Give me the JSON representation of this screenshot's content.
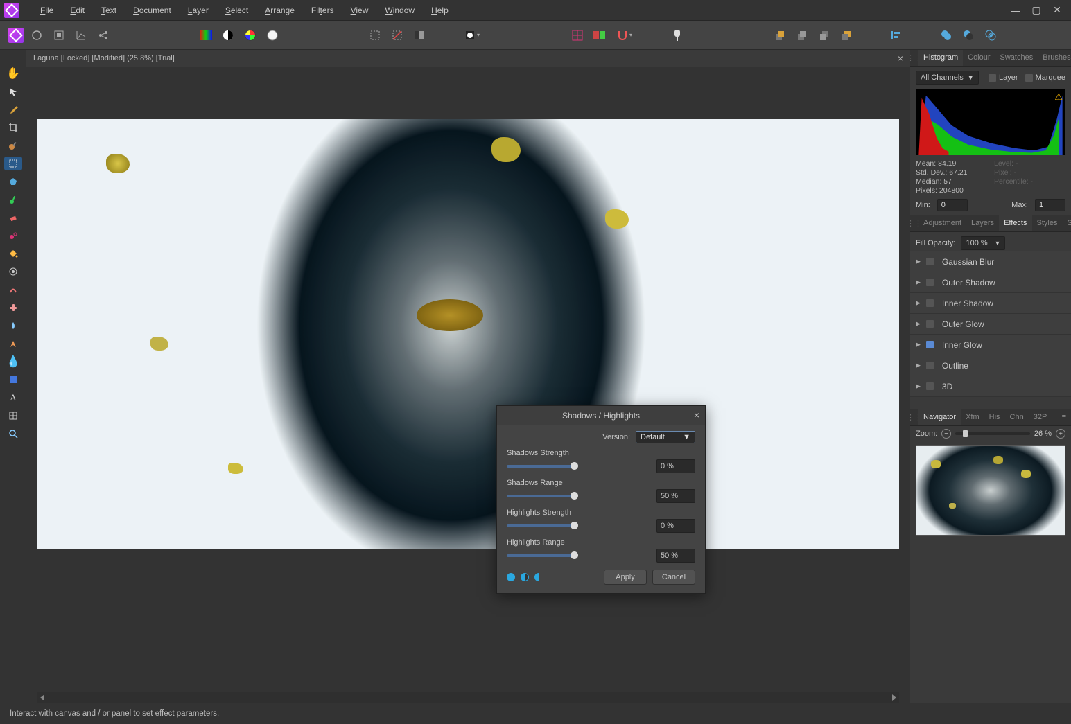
{
  "menubar": {
    "items": [
      "File",
      "Edit",
      "Text",
      "Document",
      "Layer",
      "Select",
      "Arrange",
      "Filters",
      "View",
      "Window",
      "Help"
    ]
  },
  "document": {
    "tab_label": "Laguna [Locked] [Modified] (25.8%) [Trial]"
  },
  "histogram_panel": {
    "tabs": [
      "Histogram",
      "Colour",
      "Swatches",
      "Brushes"
    ],
    "active_tab": "Histogram",
    "channel": "All Channels",
    "layer_label": "Layer",
    "marquee_label": "Marquee",
    "stats": {
      "mean_label": "Mean:",
      "mean": "84.19",
      "std_label": "Std. Dev.:",
      "std": "67.21",
      "median_label": "Median:",
      "median": "57",
      "pixels_label": "Pixels:",
      "pixels": "204800",
      "level_label": "Level:",
      "level": "-",
      "pixel2_label": "Pixel:",
      "pixel2": "-",
      "perc_label": "Percentile:",
      "perc": "-"
    },
    "min_label": "Min:",
    "min_value": "0",
    "max_label": "Max:",
    "max_value": "1"
  },
  "effects_panel": {
    "tabs": [
      "Adjustment",
      "Layers",
      "Effects",
      "Styles",
      "Stock"
    ],
    "active_tab": "Effects",
    "fill_opacity_label": "Fill Opacity:",
    "fill_opacity_value": "100 %",
    "fx": [
      {
        "name": "Gaussian Blur",
        "on": false
      },
      {
        "name": "Outer Shadow",
        "on": false
      },
      {
        "name": "Inner Shadow",
        "on": false
      },
      {
        "name": "Outer Glow",
        "on": false
      },
      {
        "name": "Inner Glow",
        "on": true
      },
      {
        "name": "Outline",
        "on": false
      },
      {
        "name": "3D",
        "on": false
      }
    ]
  },
  "navigator_panel": {
    "tabs": [
      "Navigator",
      "Xfm",
      "His",
      "Chn",
      "32P"
    ],
    "active_tab": "Navigator",
    "zoom_label": "Zoom:",
    "zoom_value": "26 %"
  },
  "dialog": {
    "title": "Shadows / Highlights",
    "version_label": "Version:",
    "version_value": "Default",
    "params": [
      {
        "label": "Shadows Strength",
        "value": "0 %"
      },
      {
        "label": "Shadows Range",
        "value": "50 %"
      },
      {
        "label": "Highlights Strength",
        "value": "0 %"
      },
      {
        "label": "Highlights Range",
        "value": "50 %"
      }
    ],
    "apply": "Apply",
    "cancel": "Cancel"
  },
  "status": {
    "text": "Interact with canvas and / or panel to set effect parameters."
  }
}
